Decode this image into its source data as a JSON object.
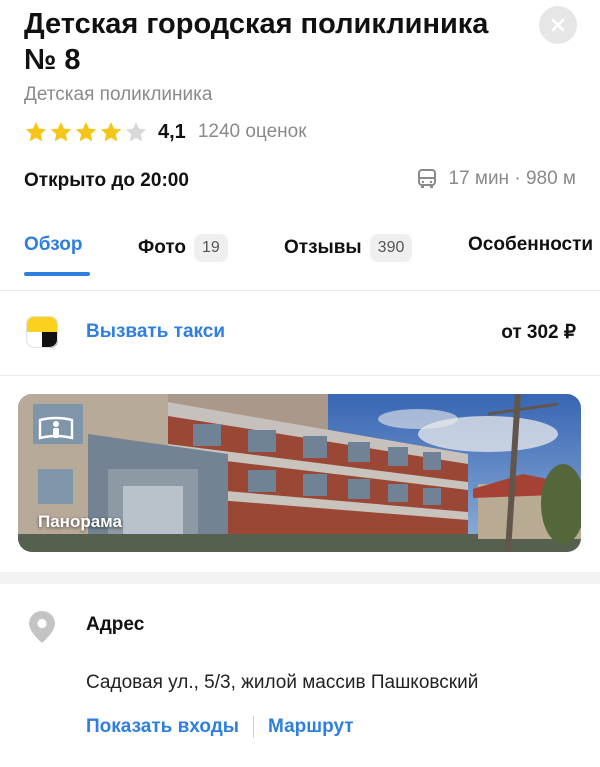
{
  "header": {
    "title": "Детская городская поликлиника № 8",
    "category": "Детская поликлиника",
    "rating_value": "4,1",
    "rating_stars": 4.1,
    "reviews_count": "1240 оценок",
    "open_status": "Открыто до 20:00",
    "transit_time": "17 мин",
    "distance": "980 м",
    "close_icon": "close-icon"
  },
  "tabs": [
    {
      "label": "Обзор",
      "badge": "",
      "active": true
    },
    {
      "label": "Фото",
      "badge": "19",
      "active": false
    },
    {
      "label": "Отзывы",
      "badge": "390",
      "active": false
    },
    {
      "label": "Особенности",
      "badge": "",
      "active": false
    }
  ],
  "taxi": {
    "label": "Вызвать такси",
    "price": "от 302 ₽"
  },
  "panorama": {
    "label": "Панорама"
  },
  "address": {
    "title": "Адрес",
    "value": "Садовая ул., 5/3, жилой массив Пашковский",
    "show_entrances": "Показать входы",
    "route": "Маршрут"
  },
  "colors": {
    "accent": "#2e7fe0",
    "star": "#f5c518",
    "muted": "#8a8a8a"
  }
}
